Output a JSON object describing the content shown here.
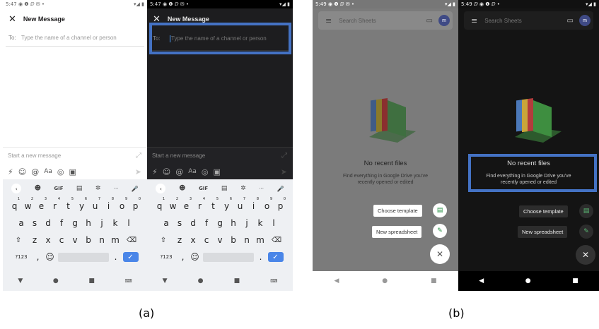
{
  "slack_light": {
    "status_time": "5:47",
    "status_notifs": "◉ ❶ ⅅ ✉ •",
    "status_right": "▾◢ ▮",
    "close_glyph": "✕",
    "title": "New Message",
    "to_label": "To:",
    "to_placeholder": "Type the name of a channel or person",
    "compose_placeholder": "Start a new message",
    "expand_glyph": "⤢",
    "tools": [
      "⚡",
      "☺",
      "@",
      "Aa",
      "◎",
      "▣"
    ],
    "send_glyph": "➤",
    "suggestions": [
      "‹",
      "☻",
      "GIF",
      "▤",
      "✲",
      "···",
      "🎤"
    ],
    "row1": [
      "q",
      "w",
      "e",
      "r",
      "t",
      "y",
      "u",
      "i",
      "o",
      "p"
    ],
    "row1_nums": [
      "1",
      "2",
      "3",
      "4",
      "5",
      "6",
      "7",
      "8",
      "9",
      "0"
    ],
    "row2": [
      "a",
      "s",
      "d",
      "f",
      "g",
      "h",
      "j",
      "k",
      "l"
    ],
    "row3": [
      "z",
      "x",
      "c",
      "v",
      "b",
      "n",
      "m"
    ],
    "shift_glyph": "⇧",
    "backspace_glyph": "⌫",
    "sym_label": "?123",
    "comma": ",",
    "emoji_glyph": "☺",
    "period": ".",
    "enter_glyph": "✓",
    "nav": [
      "▼",
      "●",
      "■",
      "⌨"
    ]
  },
  "slack_dark": {
    "status_time": "5:47",
    "status_notifs": "◉ ❶ ⅅ ✉ •",
    "status_right": "▾◢ ▮",
    "close_glyph": "✕",
    "title": "New Message",
    "to_label": "To:",
    "to_placeholder": "Type the name of a channel or person",
    "compose_placeholder": "Start a new message",
    "expand_glyph": "⤢",
    "tools": [
      "⚡",
      "☺",
      "@",
      "Aa",
      "◎",
      "▣"
    ],
    "send_glyph": "➤",
    "suggestions": [
      "‹",
      "☻",
      "GIF",
      "▤",
      "✲",
      "···",
      "🎤"
    ],
    "row1": [
      "q",
      "w",
      "e",
      "r",
      "t",
      "y",
      "u",
      "i",
      "o",
      "p"
    ],
    "row1_nums": [
      "1",
      "2",
      "3",
      "4",
      "5",
      "6",
      "7",
      "8",
      "9",
      "0"
    ],
    "row2": [
      "a",
      "s",
      "d",
      "f",
      "g",
      "h",
      "j",
      "k",
      "l"
    ],
    "row3": [
      "z",
      "x",
      "c",
      "v",
      "b",
      "n",
      "m"
    ],
    "shift_glyph": "⇧",
    "backspace_glyph": "⌫",
    "sym_label": "?123",
    "comma": ",",
    "emoji_glyph": "☺",
    "period": ".",
    "enter_glyph": "✓",
    "nav": [
      "▼",
      "●",
      "■",
      "⌨"
    ]
  },
  "sheets_light": {
    "status_time": "5:49",
    "status_notifs": "◉ ❶ ⅅ ✉ •",
    "status_right": "▾◢ ▮",
    "menu_glyph": "≡",
    "search_placeholder": "Search Sheets",
    "folder_glyph": "▭",
    "avatar_letter": "m",
    "no_recent": "No recent files",
    "find_line1": "Find everything in Google Drive you've",
    "find_line2": "recently opened or edited",
    "choose_template": "Choose template",
    "new_spreadsheet": "New spreadsheet",
    "template_glyph": "▤",
    "pencil_glyph": "✎",
    "close_glyph": "✕",
    "nav": [
      "◀",
      "●",
      "■"
    ]
  },
  "sheets_dark": {
    "status_time": "5:49",
    "status_notifs": "ⅅ ◉ ❶ ⅅ •",
    "status_right": "▾◢ ▮",
    "menu_glyph": "≡",
    "search_placeholder": "Search Sheets",
    "folder_glyph": "▭",
    "avatar_letter": "m",
    "no_recent": "No recent files",
    "find_line1": "Find everything in Google Drive you've",
    "find_line2": "recently opened or edited",
    "choose_template": "Choose template",
    "new_spreadsheet": "New spreadsheet",
    "template_glyph": "▤",
    "pencil_glyph": "✎",
    "close_glyph": "✕",
    "nav": [
      "◀",
      "●",
      "■"
    ]
  },
  "captions": {
    "a": "(a)",
    "b": "(b)"
  },
  "colors": {
    "highlight": "#4472c4",
    "enter_key": "#4a86e8",
    "avatar": "#5c6bc0"
  }
}
